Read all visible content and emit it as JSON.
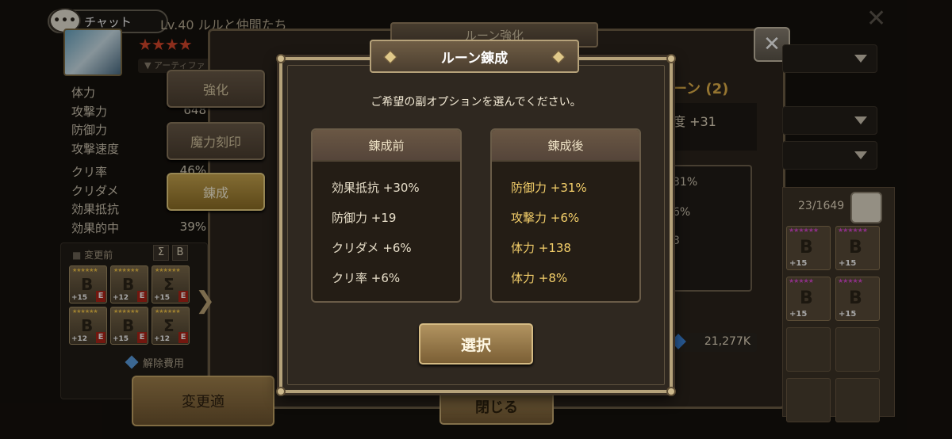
{
  "background": {
    "chat_label": "チャット",
    "chat_bubble": "•••",
    "monster_title": "Lv.40 ルルと仲間たち",
    "stars": "★★★★",
    "attribute_tag": "▼ アーティファ",
    "stats": [
      {
        "label": "体力",
        "value": ""
      },
      {
        "label": "攻撃力",
        "value": "648"
      },
      {
        "label": "防御力",
        "value": ""
      },
      {
        "label": "攻撃速度",
        "value": ""
      },
      {
        "label": "クリ率",
        "value": "46%"
      },
      {
        "label": "クリダメ",
        "value": ""
      },
      {
        "label": "効果抵抗",
        "value": ""
      },
      {
        "label": "効果的中",
        "value": "39%"
      }
    ],
    "side_buttons": [
      {
        "label": "強化",
        "active": false
      },
      {
        "label": "魔力刻印",
        "active": false
      },
      {
        "label": "錬成",
        "active": true
      }
    ],
    "rune_panel": {
      "header": "変更前",
      "sigils": [
        "Σ",
        "B"
      ],
      "slots": [
        {
          "glyph": "B",
          "level": "+15",
          "stars": "★★★★★★"
        },
        {
          "glyph": "B",
          "level": "+12",
          "stars": "★★★★★★"
        },
        {
          "glyph": "Σ",
          "level": "+15",
          "stars": "★★★★★★"
        },
        {
          "glyph": "B",
          "level": "+12",
          "stars": "★★★★★★"
        },
        {
          "glyph": "B",
          "level": "+15",
          "stars": "★★★★★★"
        },
        {
          "glyph": "Σ",
          "level": "+12",
          "stars": "★★★★★★"
        }
      ],
      "slot_tag": "E"
    },
    "next_arrow": "❯",
    "unlock_fee_label": "解除費用",
    "change_button": "変更適",
    "rune_enhance_tab": "ルーン強化",
    "close_x": "✕",
    "rune_sub_title": "ーン (2)",
    "rune_sub_value": "度 +31",
    "partial_values": [
      "31%",
      "6%",
      "3"
    ],
    "inventory_count": "23/1649",
    "inventory_slots": [
      {
        "level": "+15",
        "glyph": "B"
      },
      {
        "level": "+15",
        "glyph": "B"
      },
      {
        "level": "+15",
        "glyph": "B"
      },
      {
        "level": "+15",
        "glyph": "B"
      }
    ],
    "mana_value": "21,277K",
    "close_button": "閉じる"
  },
  "dialog": {
    "title": "ルーン錬成",
    "prompt": "ご希望の副オプションを選んでください。",
    "before": {
      "header": "錬成前",
      "lines": [
        "効果抵抗 +30%",
        "防御力 +19",
        "クリダメ +6%",
        "クリ率 +6%"
      ]
    },
    "after": {
      "header": "錬成後",
      "lines": [
        "防御力 +31%",
        "攻撃力 +6%",
        "体力 +138",
        "体力 +8%"
      ]
    },
    "select_button": "選択"
  },
  "colors": {
    "accent_gold": "#f4cf6a",
    "frame": "#b5a27a",
    "active_button": "#c9a64f"
  }
}
